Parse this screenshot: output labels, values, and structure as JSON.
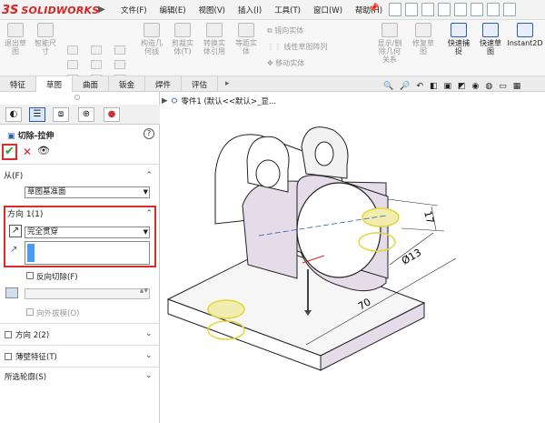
{
  "app": {
    "logo_ds": "3S",
    "logo_text": "SOLIDWORKS",
    "menu": [
      "文件(F)",
      "编辑(E)",
      "视图(V)",
      "插入(I)",
      "工具(T)",
      "窗口(W)",
      "帮助(H)"
    ]
  },
  "ribbon": {
    "buttons": [
      {
        "label": "退出草\n图"
      },
      {
        "label": "智能尺\n寸"
      },
      {
        "label": "构造几\n何线"
      },
      {
        "label": "剪裁实\n体(T)"
      },
      {
        "label": "转换实\n体引用"
      },
      {
        "label": "等距实\n体"
      },
      {
        "label": "显示/删\n除几何\n关系"
      },
      {
        "label": "修复草\n图"
      },
      {
        "label": "快速捕\n捉"
      },
      {
        "label": "快速草\n图"
      },
      {
        "label": "Instant2D"
      }
    ],
    "row_tools": [
      "镜向实体",
      "线性草图阵列",
      "移动实体"
    ]
  },
  "tabs": [
    "特征",
    "草图",
    "曲面",
    "钣金",
    "焊件",
    "评估"
  ],
  "feature_panel": {
    "title": "切除-拉伸",
    "from_label": "从(F)",
    "from_value": "草图基准面",
    "dir1_label": "方向 1(1)",
    "end_condition": "完全贯穿",
    "reverse_cut": "反向切除(F)",
    "draft_outward": "向外拔模(O)",
    "dir2_label": "方向 2(2)",
    "thin_feature": "薄壁特征(T)",
    "selected_contours": "所选轮廓(S)"
  },
  "viewport": {
    "tree_label": "零件1 (默认<<默认>_显..."
  },
  "dims": {
    "d1": "17",
    "d2": "70",
    "d3": "Ø13"
  },
  "colors": {
    "accent": "#2a5db0",
    "highlight": "#e02a2a",
    "model": "#e5dcea",
    "model_edge": "#222"
  }
}
